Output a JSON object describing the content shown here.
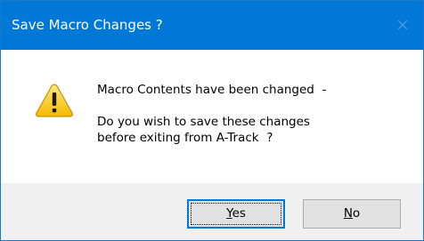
{
  "dialog": {
    "title": "Save Macro Changes ?",
    "close_icon": "close-icon",
    "warning_icon": "warning-icon",
    "message_line1": "Macro Contents have been changed  -",
    "message_line2": "Do you wish to save these changes",
    "message_line3": "before exiting from A-Track  ?"
  },
  "buttons": {
    "yes_mnemonic": "Y",
    "yes_rest": "es",
    "no_mnemonic": "N",
    "no_rest": "o"
  },
  "colors": {
    "titlebar": "#0078d7",
    "footer": "#f0f0f0",
    "button_face": "#e1e1e1",
    "default_button_border": "#0078d7"
  }
}
